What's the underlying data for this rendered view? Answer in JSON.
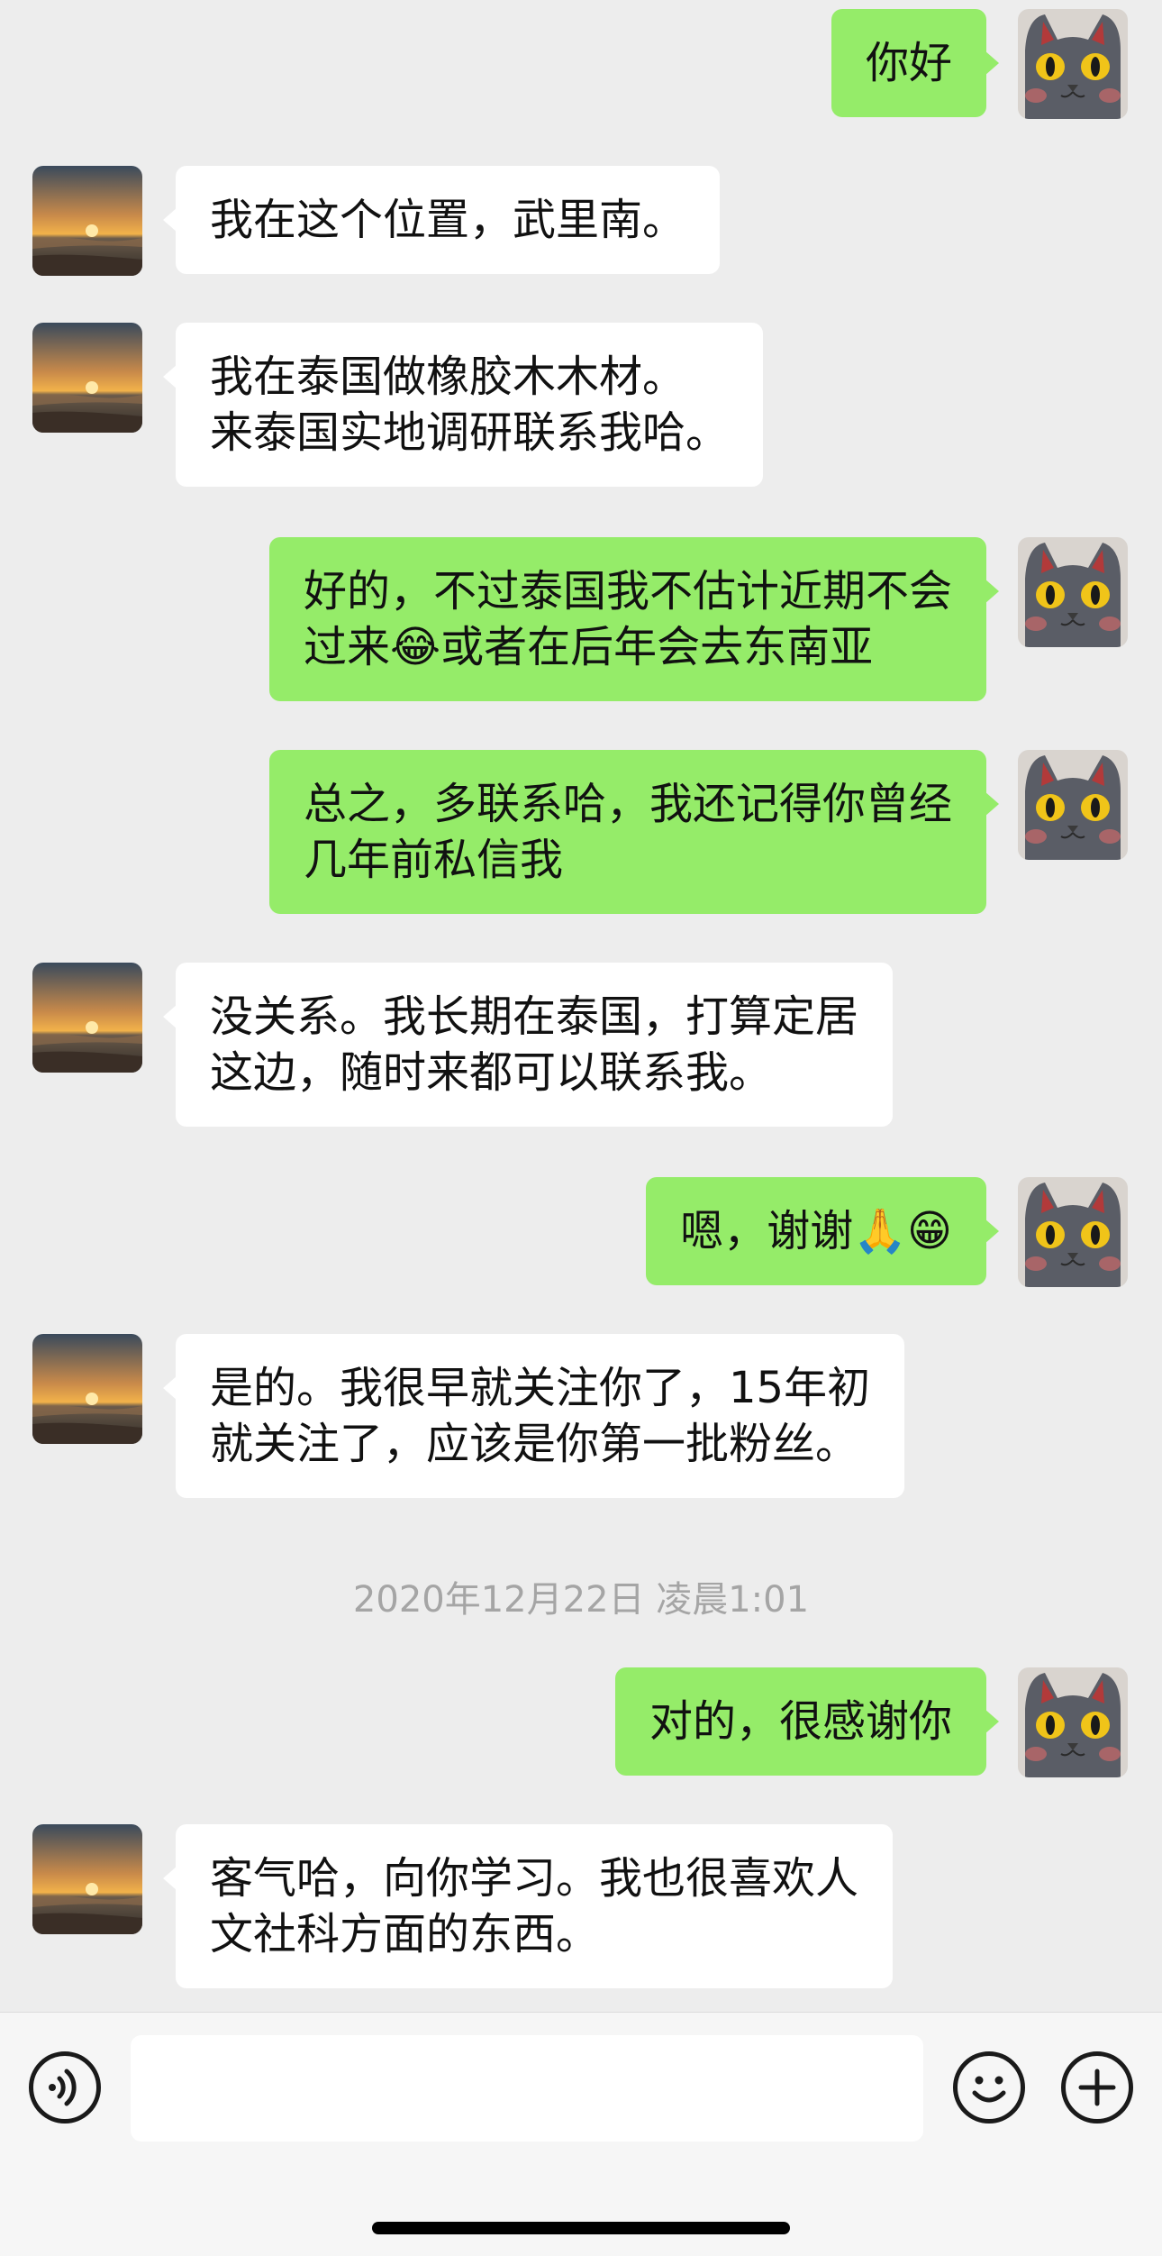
{
  "messages": [
    {
      "side": "out",
      "text": "你好"
    },
    {
      "side": "in",
      "text": "我在这个位置，武里南。"
    },
    {
      "side": "in",
      "text": "我在泰国做橡胶木木材。\n来泰国实地调研联系我哈。"
    },
    {
      "side": "out",
      "text": "好的，不过泰国我不估计近期不会\n过来😂或者在后年会去东南亚"
    },
    {
      "side": "out",
      "text": "总之，多联系哈，我还记得你曾经\n几年前私信我"
    },
    {
      "side": "in",
      "text": "没关系。我长期在泰国，打算定居\n这边，随时来都可以联系我。"
    },
    {
      "side": "out",
      "text": "嗯，谢谢🙏😁"
    },
    {
      "side": "in",
      "text": "是的。我很早就关注你了，15年初\n就关注了，应该是你第一批粉丝。"
    },
    {
      "side": "out",
      "text": "对的，很感谢你"
    },
    {
      "side": "in",
      "text": "客气哈，向你学习。我也很喜欢人\n文社科方面的东西。"
    }
  ],
  "timestamp": "2020年12月22日 凌晨1:01",
  "input": {
    "value": "",
    "placeholder": ""
  },
  "icons": {
    "voice": "voice-icon",
    "emoji": "emoji-icon",
    "plus": "plus-icon",
    "self_avatar": "cat-avatar",
    "contact_avatar": "sunset-avatar"
  },
  "colors": {
    "outgoing_bubble": "#95ec69",
    "incoming_bubble": "#ffffff",
    "background": "#ededed"
  }
}
